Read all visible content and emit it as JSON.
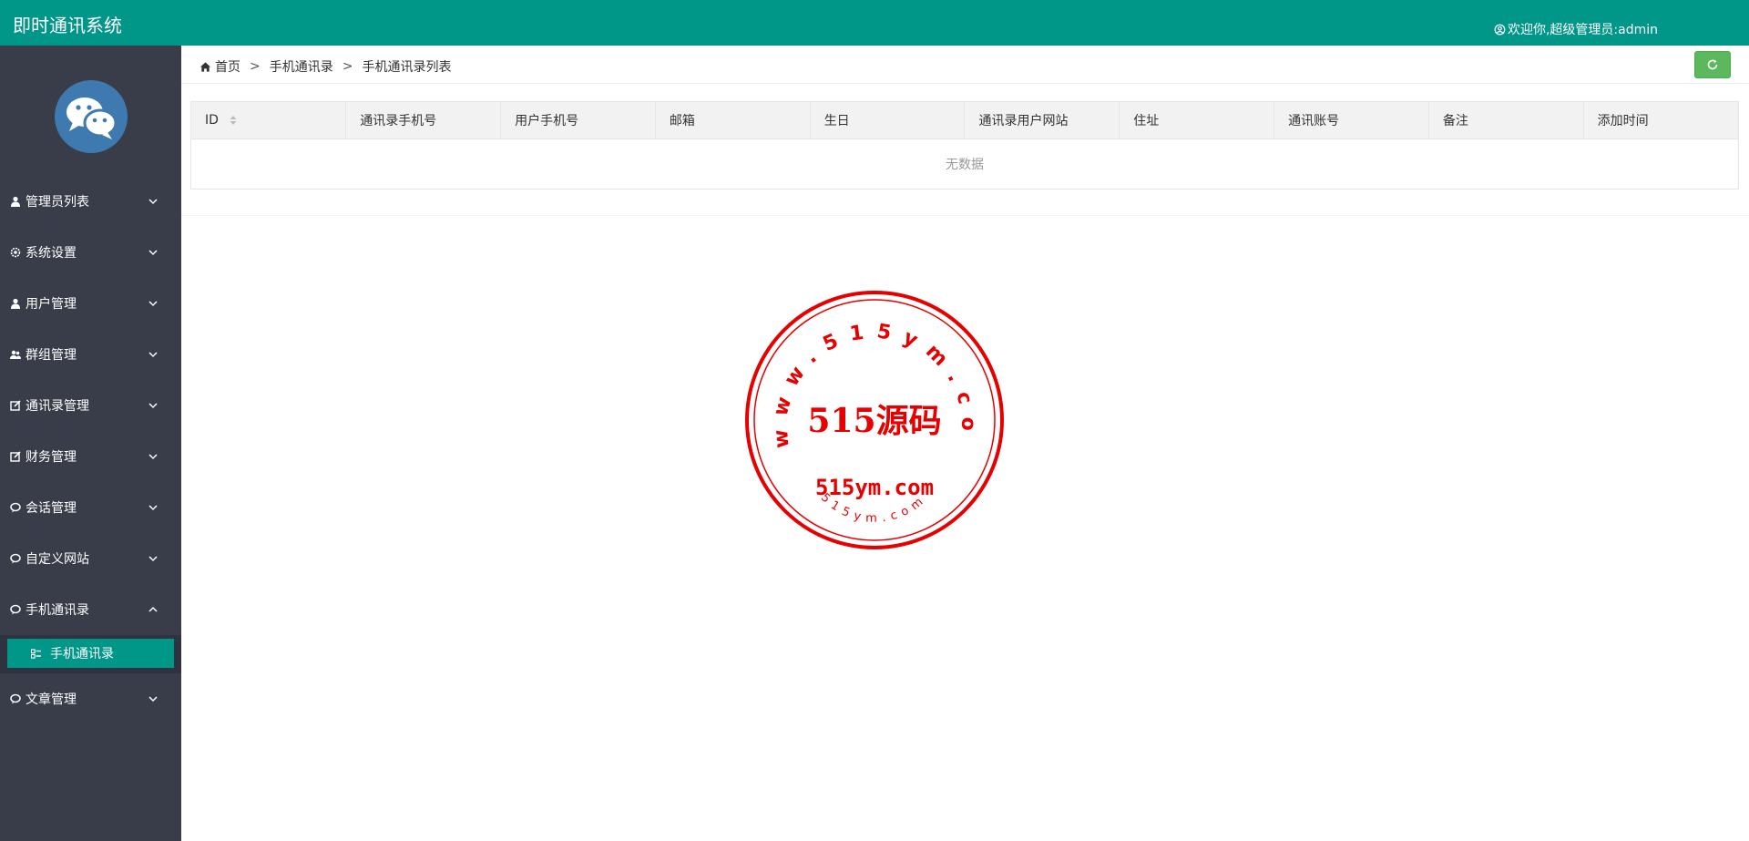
{
  "header": {
    "app_title": "即时通讯系统",
    "welcome_text": "欢迎你,超级管理员:admin"
  },
  "sidebar": {
    "logo_icon": "chat-bubbles-icon",
    "items": [
      {
        "label": "管理员列表",
        "icon": "user-icon"
      },
      {
        "label": "系统设置",
        "icon": "gear-icon"
      },
      {
        "label": "用户管理",
        "icon": "user-icon"
      },
      {
        "label": "群组管理",
        "icon": "users-icon"
      },
      {
        "label": "通讯录管理",
        "icon": "edit-icon"
      },
      {
        "label": "财务管理",
        "icon": "edit-icon"
      },
      {
        "label": "会话管理",
        "icon": "chat-icon"
      },
      {
        "label": "自定义网站",
        "icon": "chat-icon"
      },
      {
        "label": "手机通讯录",
        "icon": "chat-icon",
        "expanded": true
      },
      {
        "label": "文章管理",
        "icon": "chat-icon"
      }
    ],
    "sub_item": {
      "label": "手机通讯录",
      "icon": "list-icon"
    }
  },
  "breadcrumb": {
    "home": "首页",
    "level1": "手机通讯录",
    "level2": "手机通讯录列表",
    "separator": ">"
  },
  "table": {
    "columns": [
      "ID",
      "通讯录手机号",
      "用户手机号",
      "邮箱",
      "生日",
      "通讯录用户网站",
      "住址",
      "通讯账号",
      "备注",
      "添加时间"
    ],
    "empty_text": "无数据"
  },
  "watermark": {
    "ring_text": "www.515ym.com",
    "center_text": "515源码",
    "domain_text": "515ym.com",
    "small_text": "515ym.com"
  },
  "colors": {
    "header": "#009688",
    "sidebar": "#393d49",
    "active": "#009688",
    "refresh_button": "#5cb85c",
    "stamp": "#e60000"
  }
}
